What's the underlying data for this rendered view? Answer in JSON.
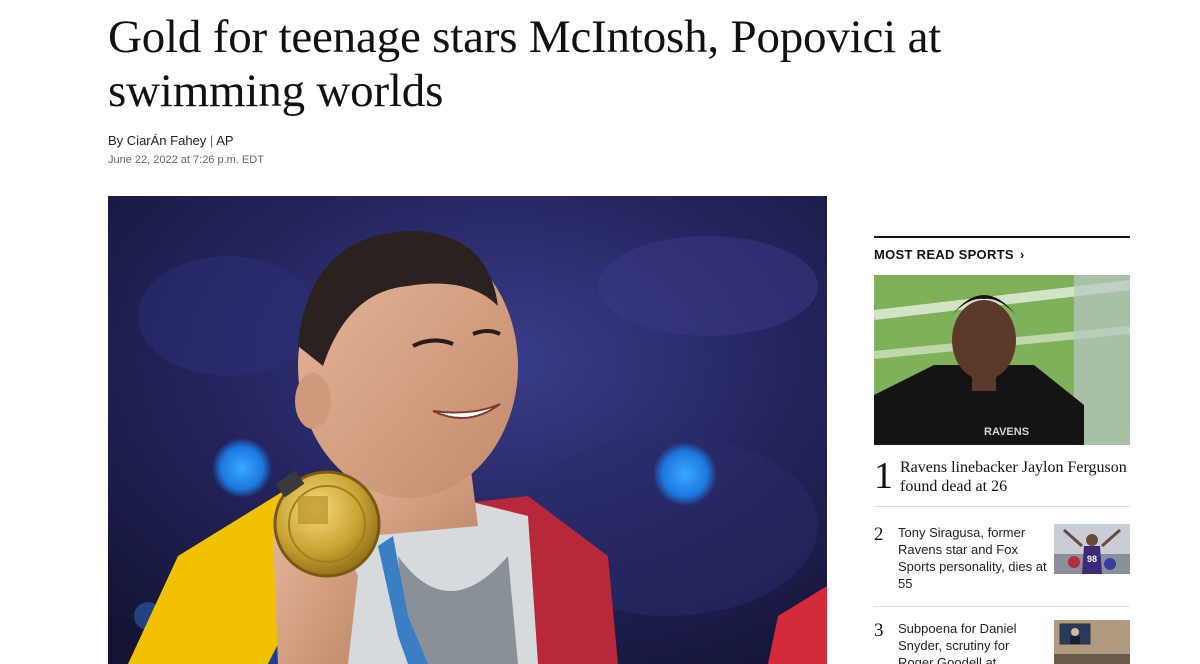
{
  "article": {
    "headline": "Gold for teenage stars McIntosh, Popovici at swimming worlds",
    "byline_prefix": "By",
    "author": "CiarÁn Fahey",
    "byline_separator": "|",
    "source": "AP",
    "dateline": "June 22, 2022 at 7:26 p.m. EDT",
    "hero_image": "Swimmer smiling and holding up a gold medal, wearing a yellow-blue-red flag"
  },
  "sidebar": {
    "heading": "MOST READ SPORTS",
    "chevron_icon": "chevron-right-icon",
    "items": [
      {
        "rank": "1",
        "title": "Ravens linebacker Jaylon Ferguson found dead at 26"
      },
      {
        "rank": "2",
        "title": "Tony Siragusa, former Ravens star and Fox Sports personality, dies at 55"
      },
      {
        "rank": "3",
        "title": "Subpoena for Daniel Snyder, scrutiny for Roger Goodell at"
      }
    ]
  },
  "colors": {
    "text": "#111111",
    "muted": "#666666",
    "rule": "#111111",
    "divider": "#dddddd"
  }
}
